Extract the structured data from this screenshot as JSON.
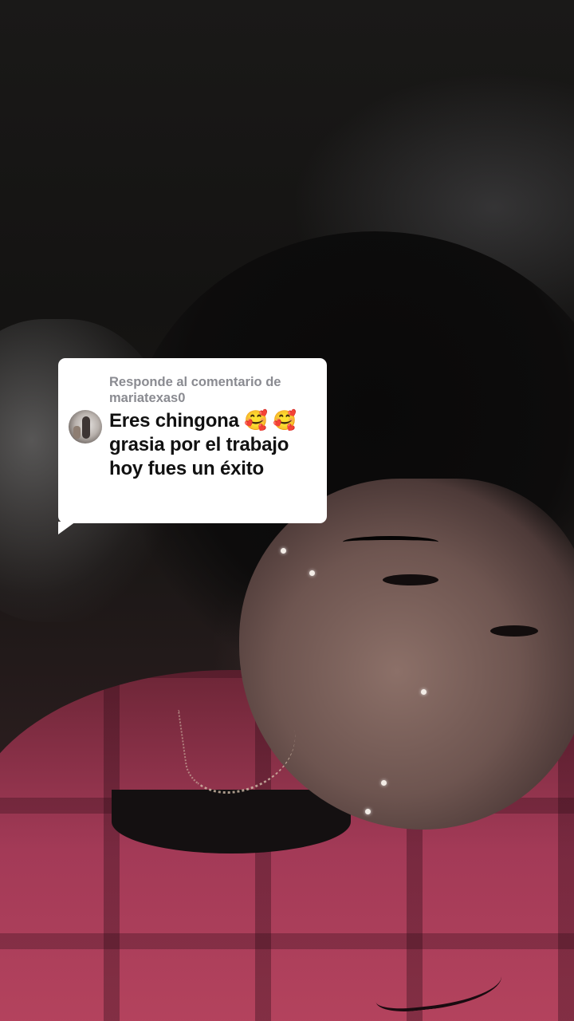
{
  "reply_sticker": {
    "header_line1": "Responde al comentario de",
    "username": "mariatexas0",
    "comment": "Eres chingona 🥰 🥰 grasia por el trabajo hoy fues un éxito"
  },
  "colors": {
    "sticker_bg": "#ffffff",
    "header_text": "#8a8b91",
    "comment_text": "#111111"
  },
  "icons": {
    "avatar": "commenter-avatar"
  }
}
